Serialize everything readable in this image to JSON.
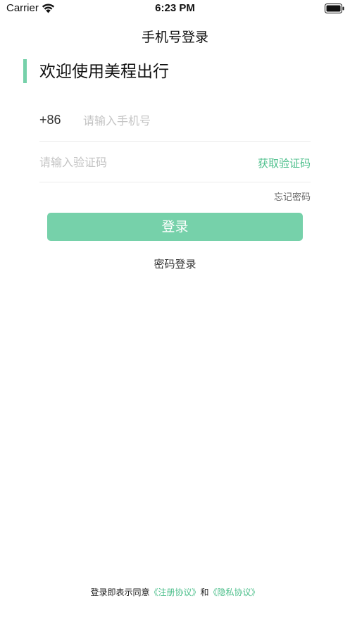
{
  "status_bar": {
    "carrier": "Carrier",
    "time": "6:23 PM",
    "wifi_icon": "wifi-icon",
    "battery_icon": "battery-icon"
  },
  "nav": {
    "title": "手机号登录"
  },
  "welcome": {
    "text": "欢迎使用美程出行",
    "accent_color": "#76d1aa"
  },
  "form": {
    "country_code": "+86",
    "phone_placeholder": "请输入手机号",
    "phone_value": "",
    "code_placeholder": "请输入验证码",
    "code_value": "",
    "get_code_label": "获取验证码",
    "forgot_password_label": "忘记密码"
  },
  "actions": {
    "login_label": "登录",
    "password_login_label": "密码登录"
  },
  "agreement": {
    "prefix": "登录即表示同意",
    "terms_link": "《注册协议》",
    "conjunction": "和",
    "privacy_link": "《隐私协议》"
  },
  "colors": {
    "brand_green": "#76d1aa",
    "link_green": "#4cbf8b"
  }
}
